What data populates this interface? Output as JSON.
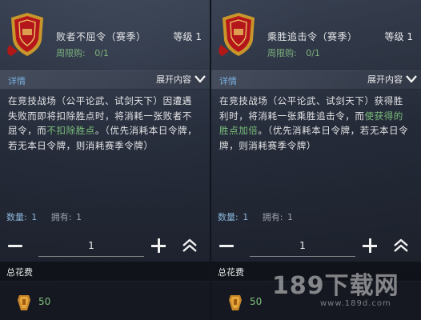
{
  "panels": [
    {
      "name": "败者不屈令（赛季）",
      "level_label": "等级",
      "level_value": "1",
      "limit_label": "周限购:",
      "limit_value": "0/1",
      "details_title": "详情",
      "expand_label": "展开内容",
      "desc_parts": [
        "在竞技战场（公平论武、试剑天下）因遭遇失败而即将扣除胜点时，将消耗一张败者不屈令，而",
        "不扣除胜点",
        "。（优先消耗本日令牌，若无本日令牌，则消耗赛季令牌）"
      ],
      "qty_label": "数量:",
      "qty_value": "1",
      "own_label": "拥有:",
      "own_value": "1",
      "stepper_value": "1",
      "total_label": "总花费",
      "cost_value": "50"
    },
    {
      "name": "乘胜追击令（赛季）",
      "level_label": "等级",
      "level_value": "1",
      "limit_label": "周限购:",
      "limit_value": "0/1",
      "details_title": "详情",
      "expand_label": "展开内容",
      "desc_parts": [
        "在竞技战场（公平论武、试剑天下）获得胜利时，将消耗一张乘胜追击令，而",
        "使获得的胜点加倍",
        "。（优先消耗本日令牌，若无本日令牌，则消耗赛季令牌）"
      ],
      "qty_label": "数量:",
      "qty_value": "1",
      "own_label": "拥有:",
      "own_value": "1",
      "stepper_value": "1",
      "total_label": "总花费",
      "cost_value": "50"
    }
  ],
  "watermark": {
    "main": "189下载网",
    "sub": "www.189d.com"
  },
  "colors": {
    "accent_blue": "#7ab0e0",
    "accent_green": "#7cc07c",
    "text_main": "#e4e4e6"
  },
  "icons": {
    "item": "red-gold-shield-token-icon",
    "currency": "gold-token-icon",
    "expand": "chevron-down-icon",
    "max": "double-chevron-up-icon"
  }
}
